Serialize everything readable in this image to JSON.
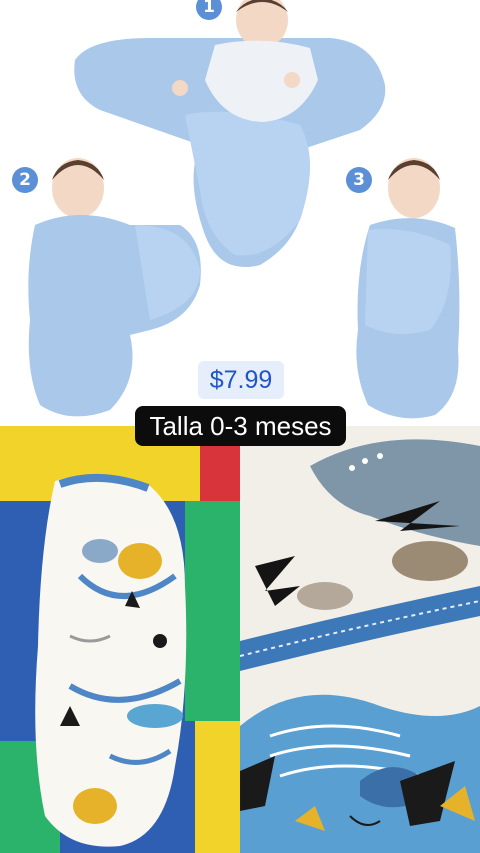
{
  "steps": [
    "1",
    "2",
    "3"
  ],
  "price": "$7.99",
  "size_label": "Talla 0-3 meses",
  "colors": {
    "swaddle_blue": "#a9c8ea",
    "badge_blue": "#5b8fd6",
    "price_text": "#1f55c9",
    "mat_yellow": "#f1d32a",
    "mat_blue": "#2f5fb3",
    "mat_green": "#2bb36b",
    "mat_red": "#d8343c"
  }
}
